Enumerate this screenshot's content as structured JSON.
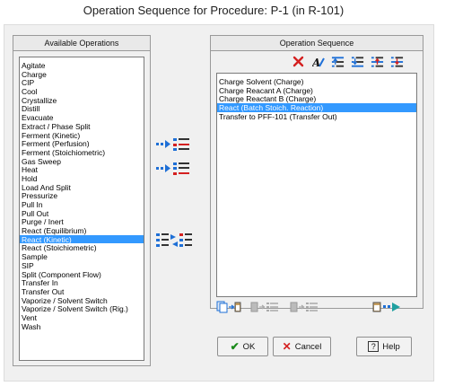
{
  "window": {
    "title": "Operation Sequence for Procedure: P-1 (in R-101)"
  },
  "available": {
    "header": "Available Operations",
    "items": [
      "Agitate",
      "Charge",
      "CIP",
      "Cool",
      "Crystallize",
      "Distill",
      "Evacuate",
      "Extract / Phase Split",
      "Ferment (Kinetic)",
      "Ferment (Perfusion)",
      "Ferment (Stoichiometric)",
      "Gas Sweep",
      "Heat",
      "Hold",
      "Load And Split",
      "Pressurize",
      "Pull In",
      "Pull Out",
      "Purge / Inert",
      "React (Equilibrium)",
      "React (Kinetic)",
      "React (Stoichiometric)",
      "Sample",
      "SIP",
      "Split (Component Flow)",
      "Transfer In",
      "Transfer Out",
      "Vaporize / Solvent Switch",
      "Vaporize / Solvent Switch (Rig.)",
      "Vent",
      "Wash"
    ],
    "selected_index": 20
  },
  "sequence": {
    "header": "Operation Sequence",
    "items": [
      "Charge Solvent (Charge)",
      "Charge Reacant A (Charge)",
      "Charge Reactant B (Charge)",
      "React (Batch Stoich. Reaction)",
      "Transfer to PFF-101 (Transfer Out)"
    ],
    "selected_index": 3
  },
  "toolbar": {
    "delete_icon": "delete-x-icon",
    "rename_icon": "rename-icon",
    "move_top_icon": "move-to-top-icon",
    "move_bottom_icon": "move-to-bottom-icon",
    "move_up_icon": "move-up-icon",
    "move_down_icon": "move-down-icon"
  },
  "middle_actions": {
    "add_after_icon": "add-after-selected-icon",
    "add_end_icon": "add-to-end-icon",
    "swap_icon": "replace-operation-icon"
  },
  "bottom_tools": {
    "copy_icon": "copy-operation-icon",
    "paste_icons": "paste-operation-icon",
    "export_icon": "export-sequence-icon"
  },
  "buttons": {
    "ok": "OK",
    "cancel": "Cancel",
    "help": "Help"
  },
  "colors": {
    "selection": "#3399ff",
    "accent_blue": "#1e6fd6",
    "delete_red": "#d42020",
    "ok_green": "#1a8a1a"
  }
}
